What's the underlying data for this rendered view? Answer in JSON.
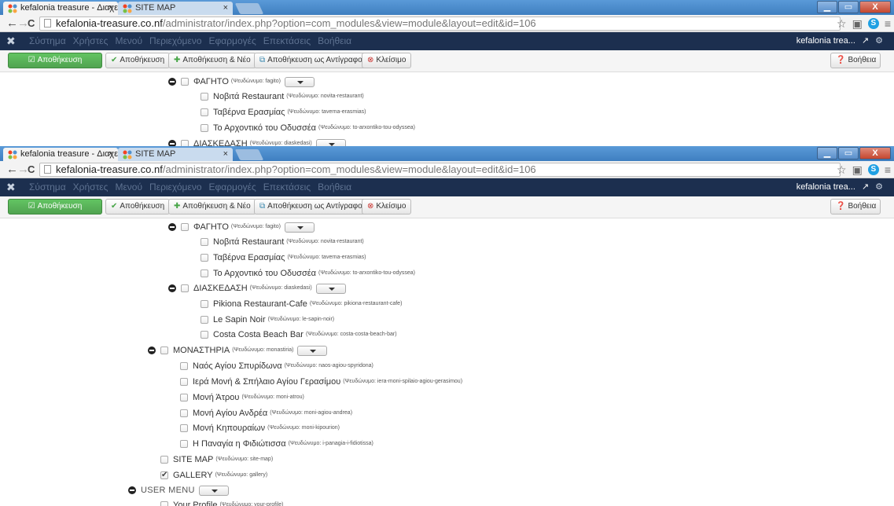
{
  "browser": {
    "tabs": [
      {
        "title": "kefalonia treasure - Διαχε",
        "close": "×"
      },
      {
        "title": "SITE MAP",
        "close": "×"
      }
    ],
    "url_host": "kefalonia-treasure.co.nf",
    "url_path": "/administrator/index.php?option=com_modules&view=module&layout=edit&id=106",
    "nav": {
      "back": "←",
      "forward": "→",
      "reload": "C"
    },
    "right_icons": {
      "star": "☆",
      "ext": "▣",
      "skype": "S",
      "menu": "≡"
    },
    "window_controls": {
      "minimize": "▁",
      "maximize": "▭",
      "close": "X"
    }
  },
  "joomla": {
    "logo": "✖",
    "menu": [
      "Σύστημα",
      "Χρήστες",
      "Μενού",
      "Περιεχόμενο",
      "Εφαρμογές",
      "Επεκτάσεις",
      "Βοήθεια"
    ],
    "site_name": "kefalonia trea...",
    "site_link_icon": "↗",
    "settings_icon": "⚙"
  },
  "toolbar": {
    "save": "Αποθήκευση",
    "save_close": "Αποθήκευση",
    "save_new": "Αποθήκευση & Νέο",
    "save_copy": "Αποθήκευση ως Αντίγραφο",
    "close": "Κλείσιμο",
    "help": "Βοήθεια"
  },
  "tree_top": {
    "fagito": {
      "title": "ΦΑΓΗΤΟ",
      "alias": "(Ψευδώνυμο: fagito)"
    },
    "items": [
      {
        "title": "Νοβιτά Restaurant",
        "alias": "(Ψευδώνυμο: novita-restaurant)"
      },
      {
        "title": "Ταβέρνα Ερασμίας",
        "alias": "(Ψευδώνυμο: taverna-erasmias)"
      },
      {
        "title": "Το Αρχοντικό του Οδυσσέα",
        "alias": "(Ψευδώνυμο: to-arxontiko-tou-odyssea)"
      }
    ],
    "partial": {
      "title": "ΔΙΑΣΚΕΔΑΣΗ",
      "alias": "(Ψευδώνυμο: diaskedasi)"
    }
  },
  "tree": {
    "fagito": {
      "title": "ΦΑΓΗΤΟ",
      "alias": "(Ψευδώνυμο: fagito)"
    },
    "fagito_items": [
      {
        "title": "Νοβιτά Restaurant",
        "alias": "(Ψευδώνυμο: novita-restaurant)"
      },
      {
        "title": "Ταβέρνα Ερασμίας",
        "alias": "(Ψευδώνυμο: taverna-erasmias)"
      },
      {
        "title": "Το Αρχοντικό του Οδυσσέα",
        "alias": "(Ψευδώνυμο: to-arxontiko-tou-odyssea)"
      }
    ],
    "diaskedasi": {
      "title": "ΔΙΑΣΚΕΔΑΣΗ",
      "alias": "(Ψευδώνυμο: diaskedasi)"
    },
    "diaskedasi_items": [
      {
        "title": "Pikiona Restaurant-Cafe",
        "alias": "(Ψευδώνυμο: pikiona-restaurant-cafe)"
      },
      {
        "title": "Le Sapin Noir",
        "alias": "(Ψευδώνυμο: le-sapin-noir)"
      },
      {
        "title": "Costa Costa Beach Bar",
        "alias": "(Ψευδώνυμο: costa-costa-beach-bar)"
      }
    ],
    "monastiria": {
      "title": "ΜΟΝΑΣΤΗΡΙΑ",
      "alias": "(Ψευδώνυμο: monastiria)"
    },
    "monastiria_items": [
      {
        "title": "Ναός Αγίου Σπυρίδωνα",
        "alias": "(Ψευδώνυμο: naos-agiou-spyridona)"
      },
      {
        "title": "Ιερά Μονή & Σπήλαιο Αγίου Γερασίμου",
        "alias": "(Ψευδώνυμο: iera-moni-spilaio-agiou-gerasimou)"
      },
      {
        "title": "Μονή Άτρου",
        "alias": "(Ψευδώνυμο: moni-atrou)"
      },
      {
        "title": "Μονή Αγίου Ανδρέα",
        "alias": "(Ψευδώνυμο: moni-agiou-andrea)"
      },
      {
        "title": "Μονή Κηπουραίων",
        "alias": "(Ψευδώνυμο: moni-kipourion)"
      },
      {
        "title": "Η Παναγία η Φιδιώτισσα",
        "alias": "(Ψευδώνυμο: i-panagia-i-fidiotissa)"
      }
    ],
    "site_map": {
      "title": "SITE MAP",
      "alias": "(Ψευδώνυμο: site-map)"
    },
    "gallery": {
      "title": "GALLERY",
      "alias": "(Ψευδώνυμο: gallery)",
      "checked": true
    },
    "user_menu": {
      "title": "USER MENU"
    },
    "your_profile": {
      "title": "Your Profile",
      "alias": "(Ψευδώνυμο: your-profile)"
    }
  }
}
